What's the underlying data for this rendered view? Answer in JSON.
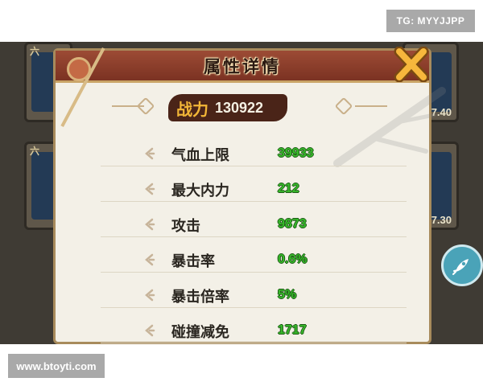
{
  "watermarks": {
    "top_right": "TG: MYYJJPP",
    "bottom_left": "www.btoyti.com"
  },
  "background": {
    "card_1_label": "六",
    "card_1_number": "7.40",
    "card_2_label": "六",
    "card_2_number": "7.30"
  },
  "dialog": {
    "title": "属性详情",
    "power_label": "战力",
    "power_value": "130922",
    "stats": [
      {
        "label": "气血上限",
        "value": "39933"
      },
      {
        "label": "最大内力",
        "value": "212"
      },
      {
        "label": "攻击",
        "value": "9873"
      },
      {
        "label": "暴击率",
        "value": "0.6%"
      },
      {
        "label": "暴击倍率",
        "value": "5%"
      },
      {
        "label": "碰撞减免",
        "value": "1717"
      }
    ]
  },
  "icons": {
    "close": "close-x-icon",
    "stat": "swirl-bullet-icon",
    "side_button": "rocket-icon"
  },
  "colors": {
    "title_bar": "#8a3d2a",
    "stat_value": "#37b82a",
    "power_label": "#f2b637",
    "dialog_bg": "#f3f0e7"
  }
}
